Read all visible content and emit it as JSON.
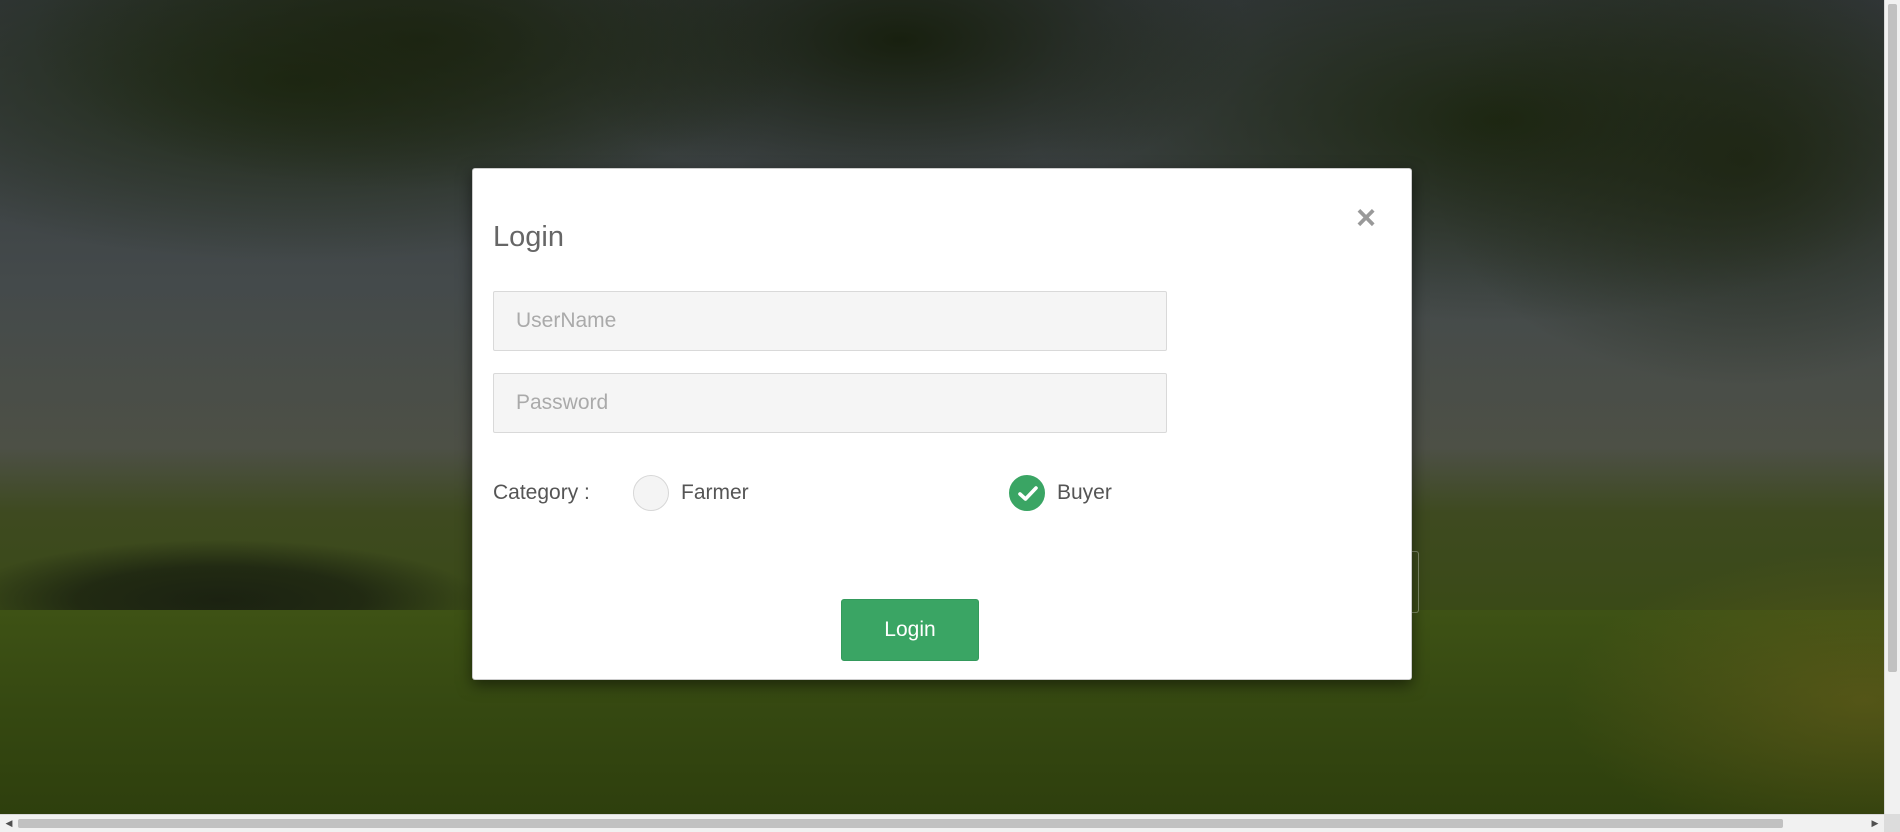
{
  "modal": {
    "title": "Login",
    "close_symbol": "×",
    "username_placeholder": "UserName",
    "password_placeholder": "Password",
    "category": {
      "label": "Category :",
      "options": [
        {
          "label": "Farmer",
          "checked": false
        },
        {
          "label": "Buyer",
          "checked": true
        }
      ]
    },
    "submit_label": "Login"
  },
  "colors": {
    "accent": "#3aa564",
    "overlay": "rgba(0,0,0,0.5)"
  },
  "icons": {
    "close": "close-icon",
    "check": "check-icon"
  }
}
